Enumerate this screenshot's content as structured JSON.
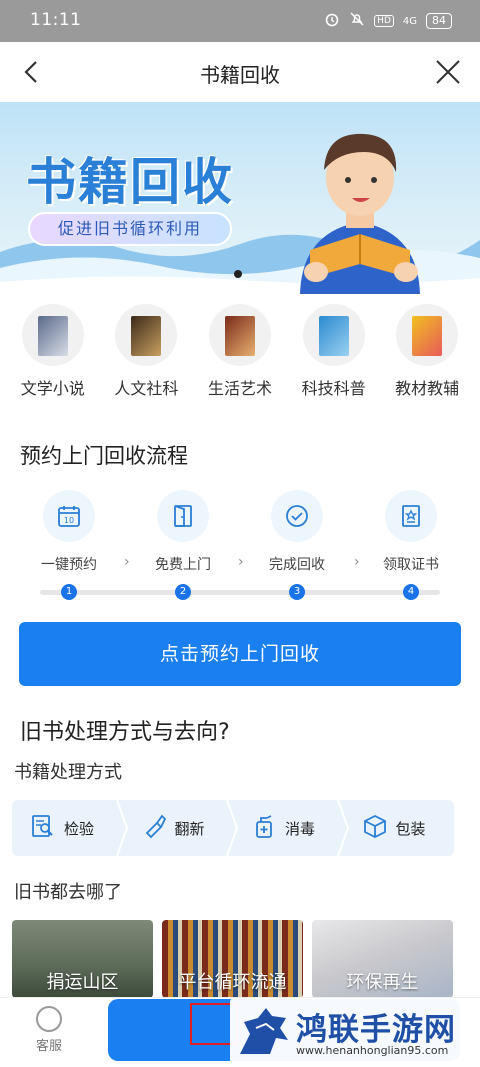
{
  "status_bar": {
    "time": "11:11",
    "battery": "84",
    "network": "4G",
    "hd": "HD"
  },
  "nav": {
    "title": "书籍回收"
  },
  "banner": {
    "headline": "书籍回收",
    "tagline": "促进旧书循环利用"
  },
  "categories": [
    {
      "label": "文学小说"
    },
    {
      "label": "人文社科"
    },
    {
      "label": "生活艺术"
    },
    {
      "label": "科技科普"
    },
    {
      "label": "教材教辅"
    }
  ],
  "flow": {
    "title": "预约上门回收流程",
    "steps": [
      {
        "label": "一键预约",
        "num": "1"
      },
      {
        "label": "免费上门",
        "num": "2"
      },
      {
        "label": "完成回收",
        "num": "3"
      },
      {
        "label": "领取证书",
        "num": "4"
      }
    ],
    "button": "点击预约上门回收"
  },
  "disposal": {
    "title": "旧书处理方式与去向?",
    "methods_title": "书籍处理方式",
    "methods": [
      {
        "label": "检验"
      },
      {
        "label": "翻新"
      },
      {
        "label": "消毒"
      },
      {
        "label": "包装"
      }
    ],
    "destination_title": "旧书都去哪了",
    "destinations": [
      {
        "label": "捐运山区"
      },
      {
        "label": "平台循环流通"
      },
      {
        "label": "环保再生"
      }
    ]
  },
  "bottom": {
    "service_label": "客服"
  },
  "watermark": {
    "title": "鸿联手游网",
    "url": "www.henanhonglian95.com"
  },
  "colors": {
    "primary": "#1a7ff1",
    "step_num": "#1a73e8",
    "status_bar": "#9a9a9a"
  }
}
